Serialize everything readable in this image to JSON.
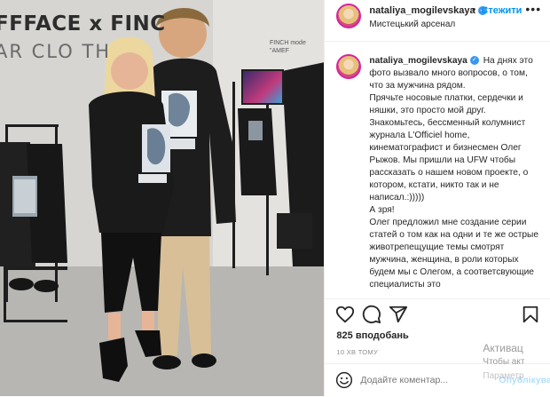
{
  "photo": {
    "backdrop_line1": "FFFACE x FINC",
    "backdrop_line2": "AR CLO TH",
    "sign_text": "FINCH mode\n\"AMEF"
  },
  "header": {
    "username": "nataliya_mogilevskaya",
    "separator": "•",
    "follow_label": "Стежити",
    "location": "Мистецький арсенал",
    "more_icon": "more-horizontal-icon"
  },
  "caption": {
    "username": "nataliya_mogilevskaya",
    "lines": [
      "На днях это фото вызвало много вопросов, о том, что за мужчина рядом.",
      "Прячьте носовые платки, сердечки и няшки, это просто мой друг.",
      "Знакомьтесь, бессменный колумнист журнала L'Officiel home, кинематографист и бизнесмен Олег Рыжов. Мы пришли на UFW чтобы рассказать о нашем новом проекте, о котором, кстати, никто так и не написал.:)))))",
      "А зря!",
      "Олег предложил мне создание серии статей о том как на одни и те же острые животрепещущие темы смотрят мужчина, женщина, в роли которых будем мы с Олегом, а соответсвующие специалисты это"
    ]
  },
  "actions": {
    "icons": [
      "heart-icon",
      "comment-icon",
      "share-icon",
      "bookmark-icon"
    ]
  },
  "likes": "825 вподобань",
  "time": "10 ХВ ТОМУ",
  "comment": {
    "placeholder": "Додайте коментар...",
    "publish_label": "Опублікувати"
  },
  "watermark": {
    "line1": "Активац",
    "line2": "Чтобы акт",
    "line3": "Параметр"
  },
  "colors": {
    "accent": "#0095f6",
    "verified": "#3897f0",
    "publish_disabled": "#b2dffc",
    "muted": "#8e8e8e"
  }
}
